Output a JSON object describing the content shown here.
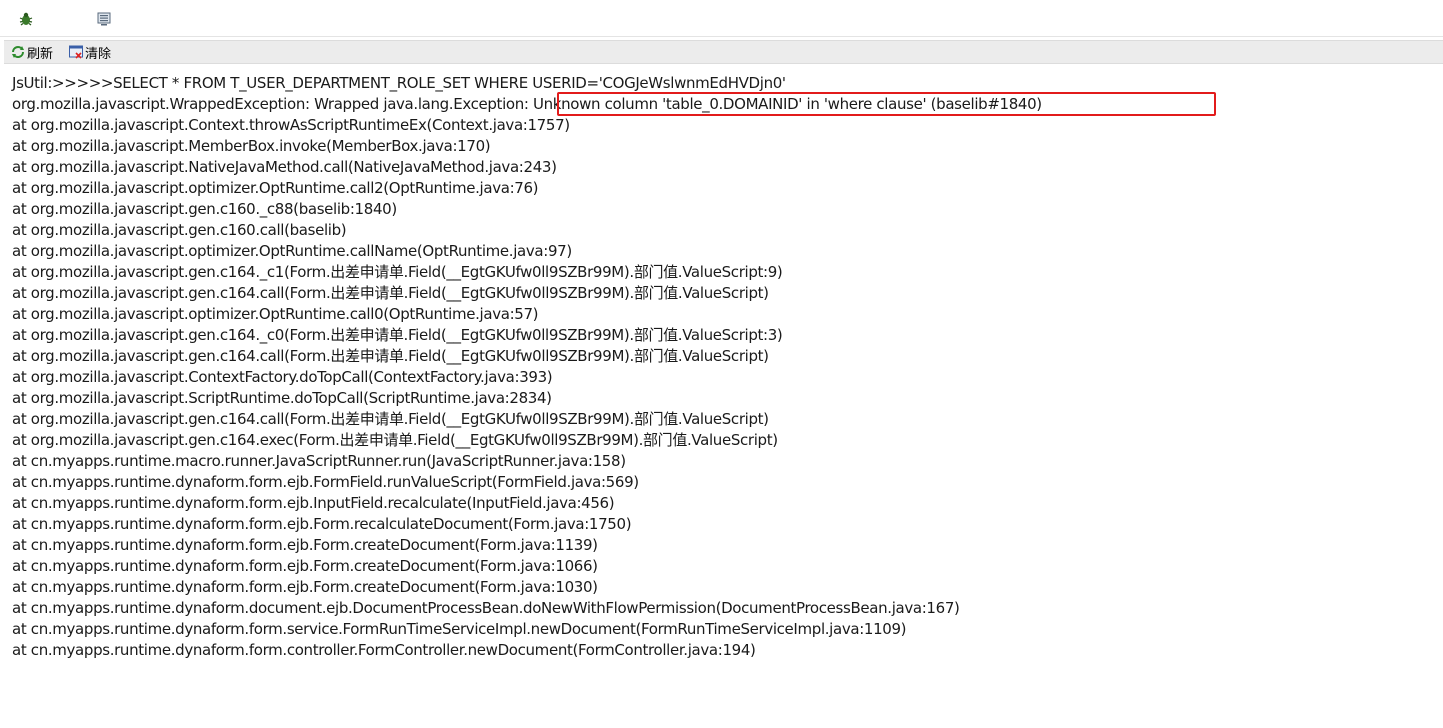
{
  "toolbar": {
    "refresh_label": "刷新",
    "clear_label": "清除"
  },
  "icons": {
    "top_left": "bug-icon",
    "top_second": "monitor-icon",
    "refresh": "refresh-icon",
    "clear": "clear-icon"
  },
  "colors": {
    "highlight_border": "#e21b1b",
    "toolbar_bg": "#ececec",
    "text": "#1a1a1a"
  },
  "console": {
    "lines": [
      "JsUtil:>>>>>SELECT * FROM T_USER_DEPARTMENT_ROLE_SET WHERE USERID='COGJeWslwnmEdHVDjn0'",
      "org.mozilla.javascript.WrappedException: Wrapped java.lang.Exception: Unknown column 'table_0.DOMAINID' in 'where clause' (baselib#1840)",
      "at org.mozilla.javascript.Context.throwAsScriptRuntimeEx(Context.java:1757)",
      "at org.mozilla.javascript.MemberBox.invoke(MemberBox.java:170)",
      "at org.mozilla.javascript.NativeJavaMethod.call(NativeJavaMethod.java:243)",
      "at org.mozilla.javascript.optimizer.OptRuntime.call2(OptRuntime.java:76)",
      "at org.mozilla.javascript.gen.c160._c88(baselib:1840)",
      "at org.mozilla.javascript.gen.c160.call(baselib)",
      "at org.mozilla.javascript.optimizer.OptRuntime.callName(OptRuntime.java:97)",
      "at org.mozilla.javascript.gen.c164._c1(Form.出差申请单.Field(__EgtGKUfw0ll9SZBr99M).部门值.ValueScript:9)",
      "at org.mozilla.javascript.gen.c164.call(Form.出差申请单.Field(__EgtGKUfw0ll9SZBr99M).部门值.ValueScript)",
      "at org.mozilla.javascript.optimizer.OptRuntime.call0(OptRuntime.java:57)",
      "at org.mozilla.javascript.gen.c164._c0(Form.出差申请单.Field(__EgtGKUfw0ll9SZBr99M).部门值.ValueScript:3)",
      "at org.mozilla.javascript.gen.c164.call(Form.出差申请单.Field(__EgtGKUfw0ll9SZBr99M).部门值.ValueScript)",
      "at org.mozilla.javascript.ContextFactory.doTopCall(ContextFactory.java:393)",
      "at org.mozilla.javascript.ScriptRuntime.doTopCall(ScriptRuntime.java:2834)",
      "at org.mozilla.javascript.gen.c164.call(Form.出差申请单.Field(__EgtGKUfw0ll9SZBr99M).部门值.ValueScript)",
      "at org.mozilla.javascript.gen.c164.exec(Form.出差申请单.Field(__EgtGKUfw0ll9SZBr99M).部门值.ValueScript)",
      "at cn.myapps.runtime.macro.runner.JavaScriptRunner.run(JavaScriptRunner.java:158)",
      "at cn.myapps.runtime.dynaform.form.ejb.FormField.runValueScript(FormField.java:569)",
      "at cn.myapps.runtime.dynaform.form.ejb.InputField.recalculate(InputField.java:456)",
      "at cn.myapps.runtime.dynaform.form.ejb.Form.recalculateDocument(Form.java:1750)",
      "at cn.myapps.runtime.dynaform.form.ejb.Form.createDocument(Form.java:1139)",
      "at cn.myapps.runtime.dynaform.form.ejb.Form.createDocument(Form.java:1066)",
      "at cn.myapps.runtime.dynaform.form.ejb.Form.createDocument(Form.java:1030)",
      "at cn.myapps.runtime.dynaform.document.ejb.DocumentProcessBean.doNewWithFlowPermission(DocumentProcessBean.java:167)",
      "at cn.myapps.runtime.dynaform.form.service.FormRunTimeServiceImpl.newDocument(FormRunTimeServiceImpl.java:1109)",
      "at cn.myapps.runtime.dynaform.form.controller.FormController.newDocument(FormController.java:194)"
    ]
  }
}
